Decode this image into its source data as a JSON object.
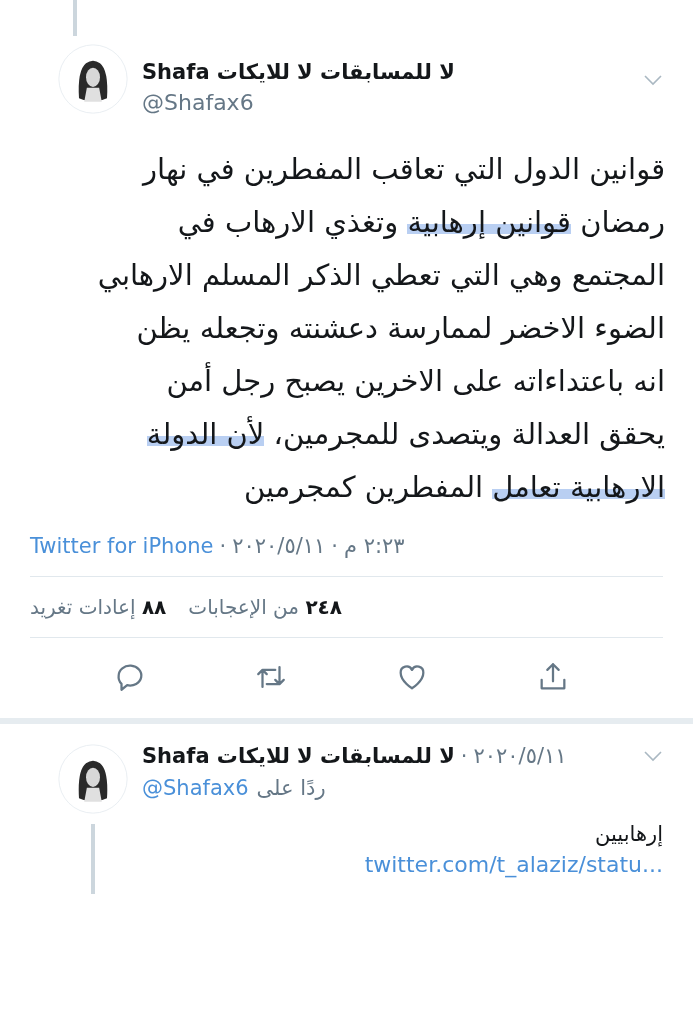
{
  "tweet": {
    "author": {
      "name": "لا للمسابقات لا للايكات Shafa",
      "handle": "@Shafax6"
    },
    "lines": [
      [
        {
          "text": "قوانين الدول التي تعاقب المفطرين في نهار",
          "highlighted": false
        }
      ],
      [
        {
          "text": "رمضان ",
          "highlighted": false
        },
        {
          "text": "قوانين إرهابية",
          "highlighted": true
        },
        {
          "text": " وتغذي الارهاب في",
          "highlighted": false
        }
      ],
      [
        {
          "text": "المجتمع وهي التي تعطي الذكر المسلم الارهابي",
          "highlighted": false
        }
      ],
      [
        {
          "text": "الضوء الاخضر لممارسة دعشنته وتجعله يظن",
          "highlighted": false
        }
      ],
      [
        {
          "text": "انه باعتداءاته على الاخرين  يصبح رجل أمن",
          "highlighted": false
        }
      ],
      [
        {
          "text": "يحقق العدالة ويتصدى للمجرمين، ",
          "highlighted": false
        },
        {
          "text": "لأن الدولة",
          "highlighted": true
        }
      ],
      [
        {
          "text": "الارهابية تعامل",
          "highlighted": true
        },
        {
          "text": " المفطرين كمجرمين",
          "highlighted": false
        }
      ]
    ],
    "separator": "·",
    "source": "Twitter for iPhone",
    "date": "٢٠٢٠/٥/١١",
    "time": "٢:٢٣ م",
    "stats": [
      {
        "count": "٢٤٨",
        "label": "من الإعجابات"
      },
      {
        "count": "٨٨",
        "label": "إعادات تغريد"
      }
    ]
  },
  "reply": {
    "separator": "·",
    "name": "لا للمسابقات لا للايكات Shafa",
    "date": "٢٠٢٠/٥/١١",
    "replying_to_label": "ردًا على",
    "replying_to_handle": "@Shafax6",
    "text": "إرهابيين",
    "link": "twitter.com/t_alaziz/statu..."
  }
}
